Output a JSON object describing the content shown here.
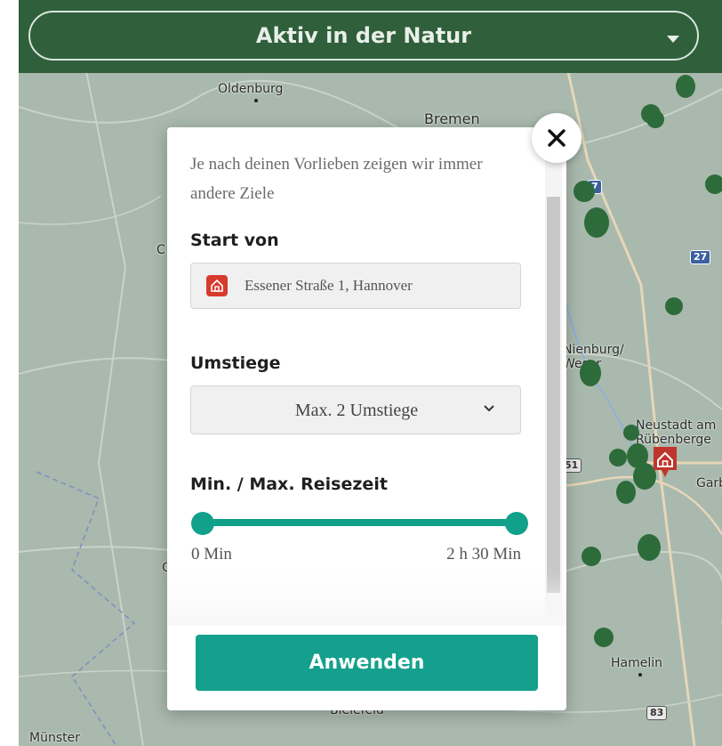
{
  "header": {
    "category_label": "Aktiv in der Natur"
  },
  "map": {
    "labels": {
      "oldenburg": "Oldenburg",
      "bremen": "Bremen",
      "nienburg": "Nienburg/\nWeser",
      "neustadt": "Neustadt am\nRübenberge",
      "garbsen": "Garb",
      "hamelin": "Hamelin",
      "bielefeld": "Bielefeld",
      "muenster": "Münster",
      "cut_c": "C",
      "cut_o": "O"
    },
    "road_shields": {
      "a27": "27",
      "a7": "7",
      "a51": "51",
      "b83": "83"
    }
  },
  "modal": {
    "intro_text": "Je nach deinen Vorlieben zeigen wir immer andere Ziele",
    "start": {
      "title": "Start von",
      "value": "Essener Straße 1, Hannover"
    },
    "transfers": {
      "title": "Umstiege",
      "selected": "Max. 2 Umstiege"
    },
    "travel_time": {
      "title": "Min. / Max. Reisezeit",
      "min_label": "0 Min",
      "max_label": "2 h 30 Min",
      "range_fraction": [
        0,
        1
      ]
    },
    "apply_label": "Anwenden"
  },
  "colors": {
    "header_green": "#2f5f3b",
    "accent_teal": "#14a08c",
    "home_red": "#d83a2d",
    "marker_green": "#2e6b3b"
  },
  "icons": {
    "close": "close-icon",
    "home": "home-icon",
    "caret": "chevron-down-icon"
  }
}
